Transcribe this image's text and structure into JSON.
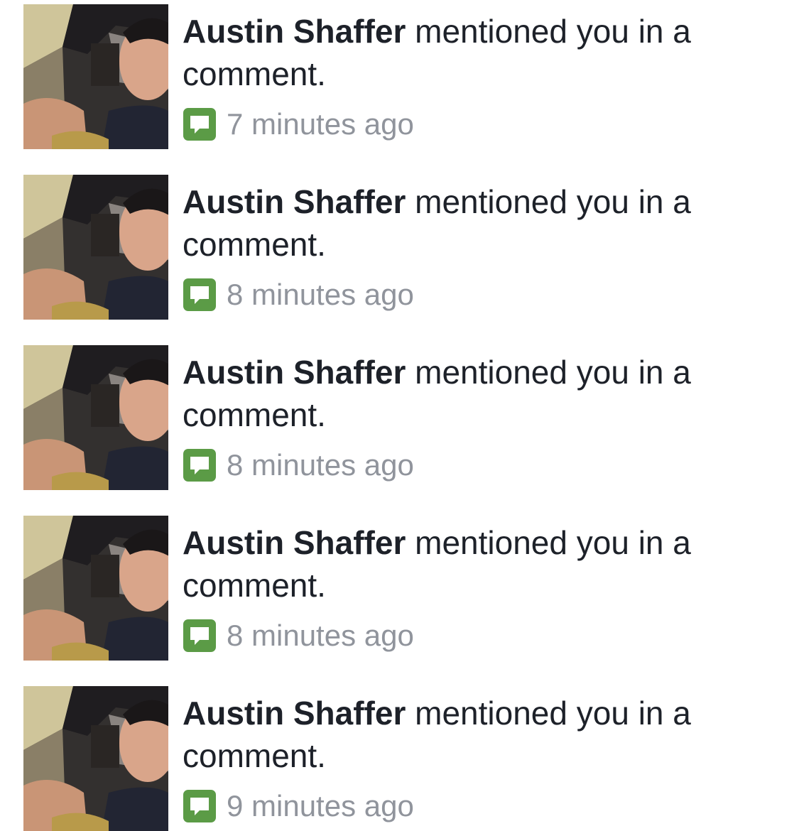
{
  "notifications": [
    {
      "name": "Austin Shaffer",
      "message": "mentioned you in a comment.",
      "time": "7 minutes ago",
      "icon": "comment-bubble-icon"
    },
    {
      "name": "Austin Shaffer",
      "message": "mentioned you in a comment.",
      "time": "8 minutes ago",
      "icon": "comment-bubble-icon"
    },
    {
      "name": "Austin Shaffer",
      "message": "mentioned you in a comment.",
      "time": "8 minutes ago",
      "icon": "comment-bubble-icon"
    },
    {
      "name": "Austin Shaffer",
      "message": "mentioned you in a comment.",
      "time": "8 minutes ago",
      "icon": "comment-bubble-icon"
    },
    {
      "name": "Austin Shaffer",
      "message": "mentioned you in a comment.",
      "time": "9 minutes ago",
      "icon": "comment-bubble-icon"
    }
  ],
  "colors": {
    "name_text": "#1d2129",
    "time_text": "#90949c",
    "icon_green": "#5b9b46"
  }
}
